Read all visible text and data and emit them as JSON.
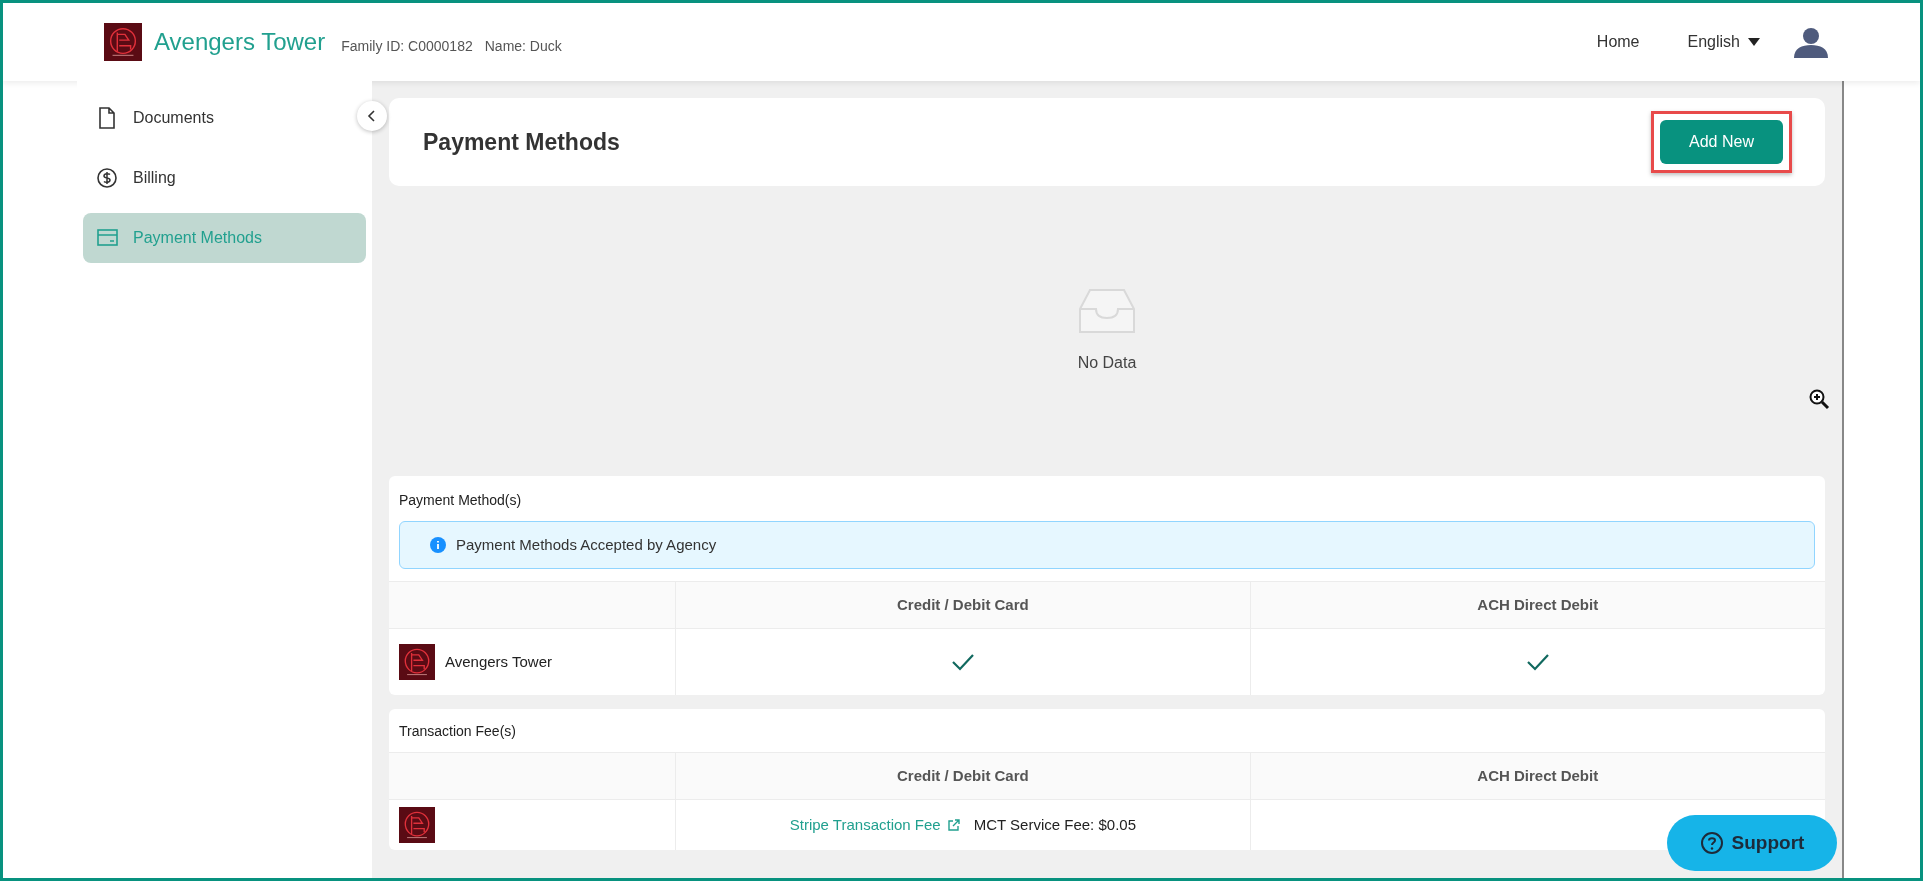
{
  "header": {
    "org_name": "Avengers Tower",
    "family_id": "Family ID: C0000182",
    "member_name": "Name: Duck",
    "nav": [
      "Home"
    ],
    "language": "English"
  },
  "sidebar": {
    "items": [
      {
        "label": "Documents",
        "kind": "document",
        "selected": false
      },
      {
        "label": "Billing",
        "kind": "billing",
        "selected": false
      },
      {
        "label": "Payment Methods",
        "kind": "card",
        "selected": true
      }
    ]
  },
  "page_title": "Payment Methods",
  "add_button": "Add New",
  "empty": {
    "text": "No Data"
  },
  "payment_methods": {
    "title": "Payment Method(s)",
    "alert": "Payment Methods Accepted by Agency",
    "columns": [
      "Credit / Debit Card",
      "ACH Direct Debit"
    ],
    "rows": [
      {
        "name": "Avengers Tower",
        "credit_card": true,
        "ach_direct_debit": true
      }
    ]
  },
  "transaction_fees": {
    "title": "Transaction Fee(s)",
    "columns": [
      "Credit / Debit Card",
      "ACH Direct Debit"
    ],
    "rows": [
      {
        "credit_card_link": "Stripe Transaction Fee",
        "credit_card_fee": "MCT Service Fee: $0.05"
      }
    ]
  },
  "support_button": "Support"
}
